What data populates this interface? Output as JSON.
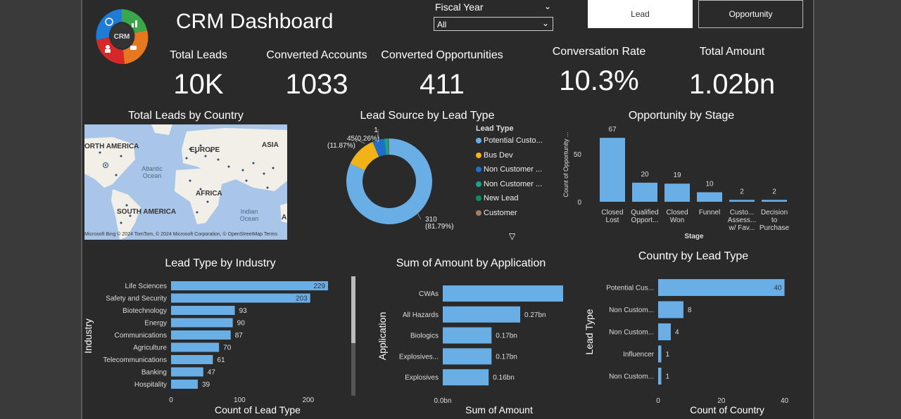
{
  "header": {
    "title": "CRM Dashboard",
    "logo_text": "CRM"
  },
  "slicer": {
    "label": "Fiscal Year",
    "value": "All"
  },
  "buttons": {
    "lead": "Lead",
    "opportunity": "Opportunity"
  },
  "kpis": [
    {
      "label": "Total Leads",
      "value": "10K"
    },
    {
      "label": "Converted Accounts",
      "value": "1033"
    },
    {
      "label": "Converted Opportunities",
      "value": "411"
    },
    {
      "label": "Conversation Rate",
      "value": "10.3%"
    },
    {
      "label": "Total Amount",
      "value": "1.02bn"
    }
  ],
  "colors": {
    "bar": "#6aaee6",
    "bus_dev": "#f2b318",
    "non_customer_1": "#1f6fc9",
    "non_customer_2": "#1aa48a",
    "new_lead": "#138a6c",
    "customer": "#a08060"
  },
  "map": {
    "title": "Total Leads by Country",
    "labels": {
      "north_america": "ORTH AMERICA",
      "europe": "EUROPE",
      "asia": "ASIA",
      "africa": "AFRICA",
      "south_america": "SOUTH AMERICA",
      "atlantic": "Atlantic Ocean",
      "indian": "Indian Ocean",
      "edge": "A"
    },
    "credit": "Microsoft Bing  © 2024 TomTom, © 2024 Microsoft Corporation, © OpenStreetMap  Terms"
  },
  "chart_data": [
    {
      "id": "lead-source",
      "type": "pie",
      "title": "Lead Source by Lead Type",
      "legend_title": "Lead Type",
      "legend_position": "right",
      "slices": [
        {
          "name": "Potential Custo...",
          "value": 310,
          "pct": "81.79%"
        },
        {
          "name": "Bus Dev",
          "value": 45,
          "pct": "11.87%"
        },
        {
          "name": "Non Customer ...",
          "value": 17,
          "pct": ""
        },
        {
          "name": "Non Customer ...",
          "value": 5,
          "pct": ""
        },
        {
          "name": "New Lead",
          "value": 1,
          "pct": "0.26%"
        },
        {
          "name": "Customer",
          "value": 1,
          "pct": ""
        }
      ],
      "data_labels": [
        {
          "text": "1"
        },
        {
          "text": "45(0.26%)"
        },
        {
          "text": "(11.87%)"
        },
        {
          "text": "310"
        },
        {
          "text": "(81.79%)"
        }
      ]
    },
    {
      "id": "opp-stage",
      "type": "bar",
      "title": "Opportunity by Stage",
      "categories": [
        [
          "Closed",
          "Lost"
        ],
        [
          "Qualified",
          "Opport..."
        ],
        [
          "Closed",
          "Won"
        ],
        [
          "Funnel"
        ],
        [
          "Custo...",
          "Assess...",
          "w/ Fav..."
        ],
        [
          "Decision",
          "to",
          "Purchase"
        ]
      ],
      "values": [
        67,
        20,
        19,
        10,
        2,
        2
      ],
      "xlabel": "Stage",
      "ylabel": "Count of Opportunity ...",
      "yticks": [
        0,
        50
      ],
      "ylim": [
        0,
        70
      ]
    },
    {
      "id": "industry",
      "type": "bar",
      "orientation": "horizontal",
      "title": "Lead Type by Industry",
      "categories": [
        "Life Sciences",
        "Safety and Security",
        "Biotechnology",
        "Energy",
        "Communications",
        "Agriculture",
        "Telecommunications",
        "Banking",
        "Hospitality"
      ],
      "values": [
        229,
        203,
        93,
        90,
        87,
        70,
        61,
        47,
        39
      ],
      "xlabel": "Count of Lead Type",
      "ylabel": "Industry",
      "xticks": [
        0,
        100,
        200
      ],
      "xlim": [
        0,
        230
      ]
    },
    {
      "id": "application",
      "type": "bar",
      "orientation": "horizontal",
      "title": "Sum of Amount by Application",
      "categories": [
        "CWAs",
        "All Hazards",
        "Biologics",
        "Explosives...",
        "Explosives"
      ],
      "values": [
        0.52,
        0.27,
        0.17,
        0.17,
        0.16
      ],
      "value_labels": [
        "0.52bn",
        "0.27bn",
        "0.17bn",
        "0.17bn",
        "0.16bn"
      ],
      "xlabel": "Sum of Amount",
      "ylabel": "Application",
      "xticks": [
        "0.0bn",
        "0.5bn"
      ],
      "xlim": [
        0,
        0.53
      ]
    },
    {
      "id": "country",
      "type": "bar",
      "orientation": "horizontal",
      "title": "Country by Lead Type",
      "categories": [
        "Potential Cus...",
        "Non Custom...",
        "Non Custom...",
        "Influencer",
        "Non Custom..."
      ],
      "values": [
        40,
        8,
        4,
        1,
        1
      ],
      "xlabel": "Count of Country",
      "ylabel": "Lead Type",
      "xticks": [
        0,
        20,
        40
      ],
      "xlim": [
        0,
        41
      ]
    }
  ]
}
